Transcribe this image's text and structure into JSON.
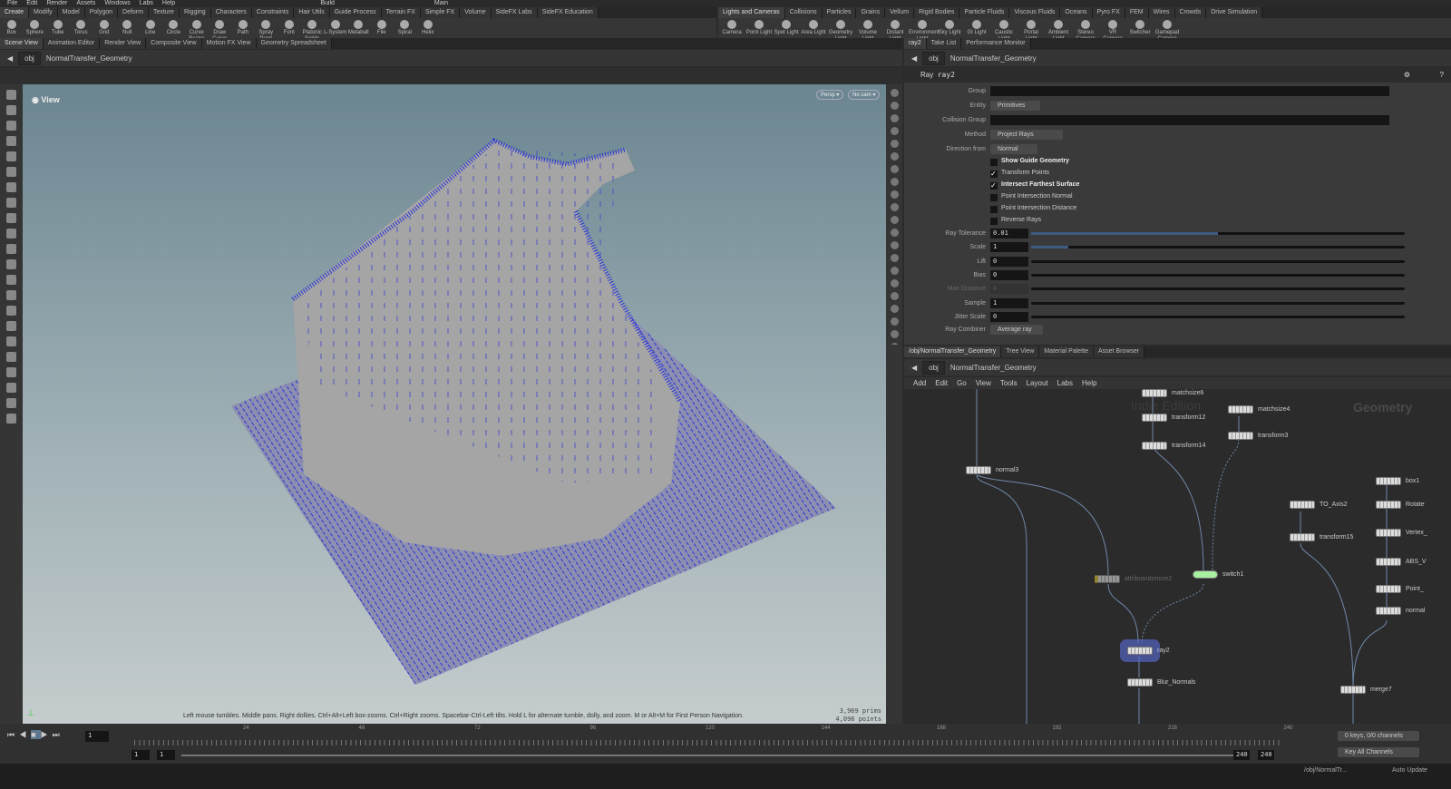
{
  "menu": {
    "items": [
      "File",
      "Edit",
      "Render",
      "Assets",
      "Windows",
      "Labs",
      "Help"
    ],
    "desktop": "Build",
    "context": "Main"
  },
  "shelf_tabs_left": [
    "Create",
    "Modify",
    "Model",
    "Polygon",
    "Deform",
    "Texture",
    "Rigging",
    "Characters",
    "Constraints",
    "Hair Utils",
    "Guide Process",
    "Terrain FX",
    "Simple FX",
    "Volume",
    "SideFX Labs",
    "SideFX Education"
  ],
  "shelf_tools_left": [
    "Box",
    "Sphere",
    "Tube",
    "Torus",
    "Grid",
    "Null",
    "Line",
    "Circle",
    "Curve Bezier",
    "Draw Curve",
    "Path",
    "Spray Paint",
    "Font",
    "Platonic Solids",
    "L-System",
    "Metaball",
    "File",
    "Spiral",
    "Helix"
  ],
  "shelf_tabs_right": [
    "Lights and Cameras",
    "Collisions",
    "Particles",
    "Grains",
    "Vellum",
    "Rigid Bodies",
    "Particle Fluids",
    "Viscous Fluids",
    "Oceans",
    "Pyro FX",
    "FEM",
    "Wires",
    "Crowds",
    "Drive Simulation"
  ],
  "shelf_tools_right": [
    "Camera",
    "Point Light",
    "Spot Light",
    "Area Light",
    "Geometry Light",
    "Volume Light",
    "Distant Light",
    "Environment Light",
    "Sky Light",
    "GI Light",
    "Caustic Light",
    "Portal Light",
    "Ambient Light",
    "Stereo Camera",
    "VR Camera",
    "Switcher",
    "Gamepad Camera"
  ],
  "pane_tabs_left": [
    "Scene View",
    "Animation Editor",
    "Render View",
    "Composite View",
    "Motion FX View",
    "Geometry Spreadsheet"
  ],
  "pane_tabs_right": [
    "ray2",
    "Take List",
    "Performance Monitor"
  ],
  "path": {
    "root": "obj",
    "node": "NormalTransfer_Geometry"
  },
  "viewport": {
    "title": "View",
    "persp": "Persp ▾",
    "cam": "No cam ▾",
    "hint": "Left mouse tumbles. Middle pans. Right dollies. Ctrl+Alt+Left box-zooms. Ctrl+Right zooms. Spacebar-Ctrl-Left tilts. Hold L for alternate tumble, dolly, and zoom. M or Alt+M for First Person Navigation.",
    "prims": "3,969  prims",
    "points": "4,096 points"
  },
  "params": {
    "type": "Ray",
    "name": "ray2",
    "group_label": "Group",
    "entity_label": "Entity",
    "entity": "Primitives",
    "collision_label": "Collision Group",
    "method_label": "Method",
    "method": "Project Rays",
    "direction_label": "Direction from",
    "direction": "Normal",
    "checks": [
      {
        "label": "Show Guide Geometry",
        "on": false
      },
      {
        "label": "Transform Points",
        "on": true
      },
      {
        "label": "Intersect Farthest Surface",
        "on": true
      },
      {
        "label": "Point Intersection Normal",
        "on": false
      },
      {
        "label": "Point Intersection Distance",
        "on": false
      },
      {
        "label": "Reverse Rays",
        "on": false
      }
    ],
    "sliders": [
      {
        "label": "Ray Tolerance",
        "value": "0.01",
        "fill": 0.5
      },
      {
        "label": "Scale",
        "value": "1",
        "fill": 0.1
      },
      {
        "label": "Lift",
        "value": "0",
        "fill": 0
      },
      {
        "label": "Bias",
        "value": "0",
        "fill": 0
      },
      {
        "label": "Max Distance",
        "value": "0",
        "fill": 0
      },
      {
        "label": "Sample",
        "value": "1",
        "fill": 0
      },
      {
        "label": "Jitter Scale",
        "value": "0",
        "fill": 0
      }
    ],
    "combiner_label": "Ray Combiner",
    "combiner": "Average ray"
  },
  "network_tabs": [
    "/obj/NormalTransfer_Geometry",
    "Tree View",
    "Material Palette",
    "Asset Browser"
  ],
  "network_menu": [
    "Add",
    "Edit",
    "Go",
    "View",
    "Tools",
    "Layout",
    "Labs",
    "Help"
  ],
  "network_watermark": "Indie Edition",
  "network_context": "Geometry",
  "nodes": [
    "matchsize6",
    "transform12",
    "transform14",
    "matchsize4",
    "transform3",
    "normal3",
    "switch1",
    "attribrandomize2",
    "ray2",
    "Blur_Normals",
    "TO_Axis2",
    "transform15",
    "box1",
    "Rotate",
    "Vertex_",
    "ABS_V",
    "Point_",
    "normal",
    "merge7"
  ],
  "timeline": {
    "frame": "1",
    "ticks": [
      "24",
      "48",
      "72",
      "96",
      "120",
      "144",
      "168",
      "192",
      "216",
      "240"
    ],
    "start": "1",
    "start2": "1",
    "end": "240",
    "end2": "240",
    "keys": "0 keys, 0/0 channels",
    "key_all": "Key All Channels",
    "status_path": "/obj/NormalTr...",
    "auto_update": "Auto Update"
  }
}
